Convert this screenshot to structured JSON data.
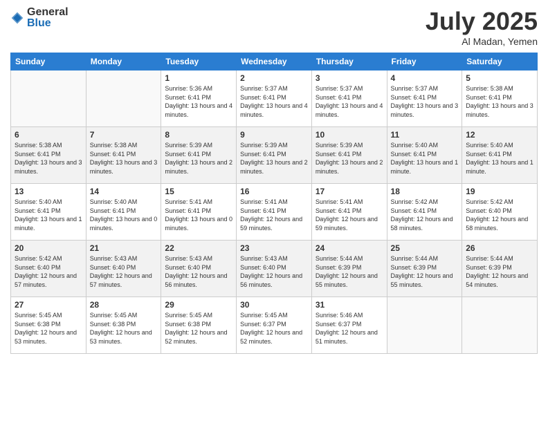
{
  "logo": {
    "general": "General",
    "blue": "Blue"
  },
  "title": "July 2025",
  "subtitle": "Al Madan, Yemen",
  "weekdays": [
    "Sunday",
    "Monday",
    "Tuesday",
    "Wednesday",
    "Thursday",
    "Friday",
    "Saturday"
  ],
  "weeks": [
    [
      {
        "day": "",
        "info": ""
      },
      {
        "day": "",
        "info": ""
      },
      {
        "day": "1",
        "info": "Sunrise: 5:36 AM\nSunset: 6:41 PM\nDaylight: 13 hours and 4 minutes."
      },
      {
        "day": "2",
        "info": "Sunrise: 5:37 AM\nSunset: 6:41 PM\nDaylight: 13 hours and 4 minutes."
      },
      {
        "day": "3",
        "info": "Sunrise: 5:37 AM\nSunset: 6:41 PM\nDaylight: 13 hours and 4 minutes."
      },
      {
        "day": "4",
        "info": "Sunrise: 5:37 AM\nSunset: 6:41 PM\nDaylight: 13 hours and 3 minutes."
      },
      {
        "day": "5",
        "info": "Sunrise: 5:38 AM\nSunset: 6:41 PM\nDaylight: 13 hours and 3 minutes."
      }
    ],
    [
      {
        "day": "6",
        "info": "Sunrise: 5:38 AM\nSunset: 6:41 PM\nDaylight: 13 hours and 3 minutes."
      },
      {
        "day": "7",
        "info": "Sunrise: 5:38 AM\nSunset: 6:41 PM\nDaylight: 13 hours and 3 minutes."
      },
      {
        "day": "8",
        "info": "Sunrise: 5:39 AM\nSunset: 6:41 PM\nDaylight: 13 hours and 2 minutes."
      },
      {
        "day": "9",
        "info": "Sunrise: 5:39 AM\nSunset: 6:41 PM\nDaylight: 13 hours and 2 minutes."
      },
      {
        "day": "10",
        "info": "Sunrise: 5:39 AM\nSunset: 6:41 PM\nDaylight: 13 hours and 2 minutes."
      },
      {
        "day": "11",
        "info": "Sunrise: 5:40 AM\nSunset: 6:41 PM\nDaylight: 13 hours and 1 minute."
      },
      {
        "day": "12",
        "info": "Sunrise: 5:40 AM\nSunset: 6:41 PM\nDaylight: 13 hours and 1 minute."
      }
    ],
    [
      {
        "day": "13",
        "info": "Sunrise: 5:40 AM\nSunset: 6:41 PM\nDaylight: 13 hours and 1 minute."
      },
      {
        "day": "14",
        "info": "Sunrise: 5:40 AM\nSunset: 6:41 PM\nDaylight: 13 hours and 0 minutes."
      },
      {
        "day": "15",
        "info": "Sunrise: 5:41 AM\nSunset: 6:41 PM\nDaylight: 13 hours and 0 minutes."
      },
      {
        "day": "16",
        "info": "Sunrise: 5:41 AM\nSunset: 6:41 PM\nDaylight: 12 hours and 59 minutes."
      },
      {
        "day": "17",
        "info": "Sunrise: 5:41 AM\nSunset: 6:41 PM\nDaylight: 12 hours and 59 minutes."
      },
      {
        "day": "18",
        "info": "Sunrise: 5:42 AM\nSunset: 6:41 PM\nDaylight: 12 hours and 58 minutes."
      },
      {
        "day": "19",
        "info": "Sunrise: 5:42 AM\nSunset: 6:40 PM\nDaylight: 12 hours and 58 minutes."
      }
    ],
    [
      {
        "day": "20",
        "info": "Sunrise: 5:42 AM\nSunset: 6:40 PM\nDaylight: 12 hours and 57 minutes."
      },
      {
        "day": "21",
        "info": "Sunrise: 5:43 AM\nSunset: 6:40 PM\nDaylight: 12 hours and 57 minutes."
      },
      {
        "day": "22",
        "info": "Sunrise: 5:43 AM\nSunset: 6:40 PM\nDaylight: 12 hours and 56 minutes."
      },
      {
        "day": "23",
        "info": "Sunrise: 5:43 AM\nSunset: 6:40 PM\nDaylight: 12 hours and 56 minutes."
      },
      {
        "day": "24",
        "info": "Sunrise: 5:44 AM\nSunset: 6:39 PM\nDaylight: 12 hours and 55 minutes."
      },
      {
        "day": "25",
        "info": "Sunrise: 5:44 AM\nSunset: 6:39 PM\nDaylight: 12 hours and 55 minutes."
      },
      {
        "day": "26",
        "info": "Sunrise: 5:44 AM\nSunset: 6:39 PM\nDaylight: 12 hours and 54 minutes."
      }
    ],
    [
      {
        "day": "27",
        "info": "Sunrise: 5:45 AM\nSunset: 6:38 PM\nDaylight: 12 hours and 53 minutes."
      },
      {
        "day": "28",
        "info": "Sunrise: 5:45 AM\nSunset: 6:38 PM\nDaylight: 12 hours and 53 minutes."
      },
      {
        "day": "29",
        "info": "Sunrise: 5:45 AM\nSunset: 6:38 PM\nDaylight: 12 hours and 52 minutes."
      },
      {
        "day": "30",
        "info": "Sunrise: 5:45 AM\nSunset: 6:37 PM\nDaylight: 12 hours and 52 minutes."
      },
      {
        "day": "31",
        "info": "Sunrise: 5:46 AM\nSunset: 6:37 PM\nDaylight: 12 hours and 51 minutes."
      },
      {
        "day": "",
        "info": ""
      },
      {
        "day": "",
        "info": ""
      }
    ]
  ]
}
